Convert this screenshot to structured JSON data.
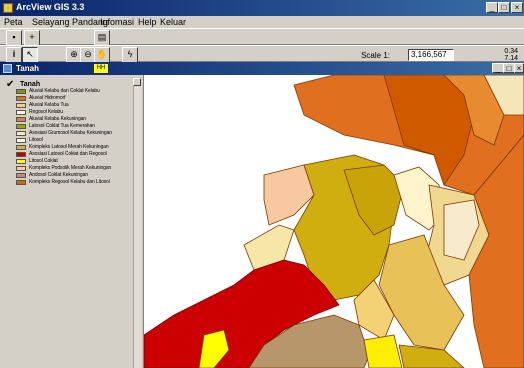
{
  "window": {
    "title": "ArcView GIS 3.3",
    "minimize": "_",
    "maximize": "□",
    "close": "×"
  },
  "menu": {
    "items": [
      "Peta",
      "Selayang Pandang",
      "Infomasi",
      "Help",
      "Keluar"
    ]
  },
  "toolbar": {
    "scale_label": "Scale 1:",
    "scale_value": "3,166,567",
    "coord_x": "0.34",
    "coord_y": "7.14"
  },
  "view": {
    "title": "Tanah",
    "badge": "HH"
  },
  "toc": {
    "layer_name": "Tanah",
    "legend": [
      {
        "label": "Aluvial Kelabu dan Coklat Kelabu",
        "color": "#8a8a20"
      },
      {
        "label": "Aluvial Hidromorf",
        "color": "#e07020"
      },
      {
        "label": "Aluvial Kelabu Tua",
        "color": "#f0d080"
      },
      {
        "label": "Regosol Kelabu",
        "color": "#fff4c8"
      },
      {
        "label": "Aluvial Kelabu Kekuningan",
        "color": "#d88040"
      },
      {
        "label": "Latosol Coklat Tua Kemerahan",
        "color": "#a0a000"
      },
      {
        "label": "Asosiasi Grumosol Kelabu Kekuningan",
        "color": "#f8e8b0"
      },
      {
        "label": "Litosol",
        "color": "#fff8e0"
      },
      {
        "label": "Kompleks Latosol Merah Kekuningan",
        "color": "#d0b040"
      },
      {
        "label": "Asosiasi Latosol Coklat dan Regosol",
        "color": "#c00000"
      },
      {
        "label": "Litosol Coklat",
        "color": "#ffff00"
      },
      {
        "label": "Kompleks Podsolik Merah Kekuningan",
        "color": "#f8c890"
      },
      {
        "label": "Andosol Coklat Kekuningan",
        "color": "#b89070"
      },
      {
        "label": "Kompleks Regosol Kelabu dan Litosol",
        "color": "#c07000"
      }
    ]
  }
}
